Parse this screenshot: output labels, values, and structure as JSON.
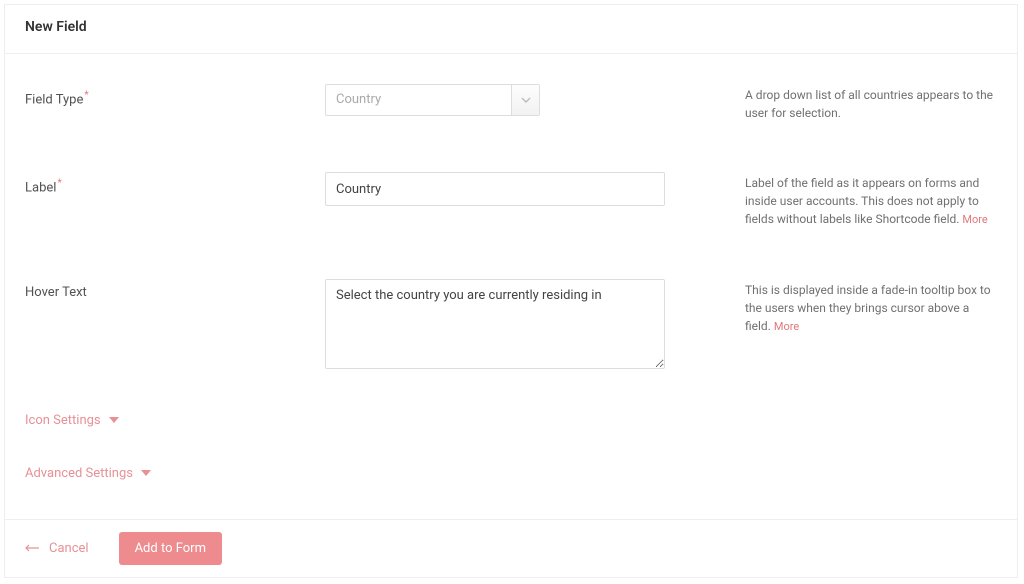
{
  "header": {
    "title": "New Field"
  },
  "rows": {
    "fieldType": {
      "label": "Field Type",
      "required": true,
      "value": "Country",
      "help": "A drop down list of all countries appears to the user for selection."
    },
    "label": {
      "label": "Label",
      "required": true,
      "value": "Country",
      "help": "Label of the field as it appears on forms and inside user accounts. This does not apply to fields without labels like Shortcode field.",
      "moreText": "More"
    },
    "hoverText": {
      "label": "Hover Text",
      "required": false,
      "value": "Select the country you are currently residing in",
      "help": "This is displayed inside a fade-in tooltip box to the users when they brings cursor above a field.",
      "moreText": "More"
    }
  },
  "sections": {
    "icon": "Icon Settings",
    "advanced": "Advanced Settings"
  },
  "footer": {
    "cancel": "Cancel",
    "submit": "Add to Form"
  }
}
